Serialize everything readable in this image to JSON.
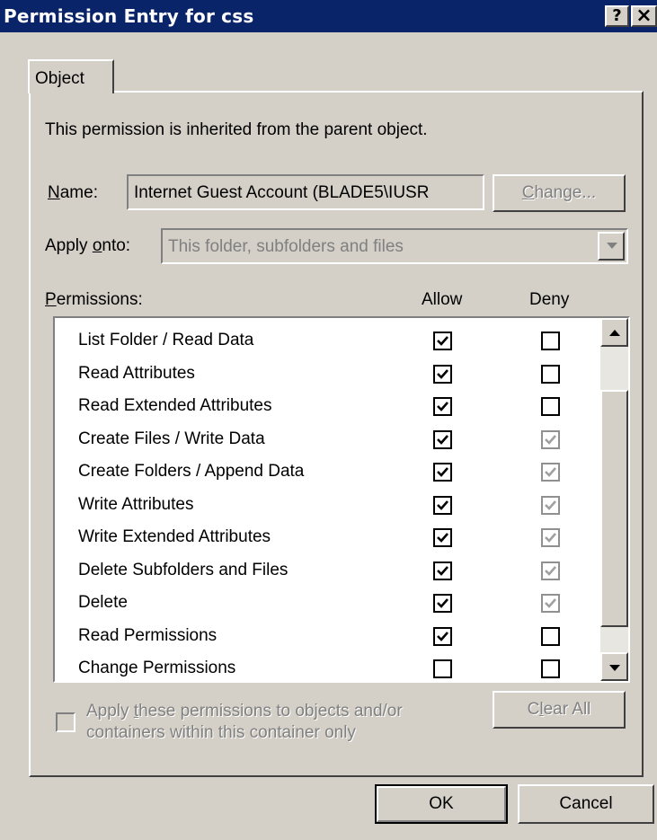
{
  "window": {
    "title": "Permission Entry for css",
    "help_btn": "?",
    "close_btn": "×"
  },
  "tab": {
    "label": "Object"
  },
  "inherited_text": "This permission is inherited from the parent object.",
  "name": {
    "label_u": "N",
    "label_rest": "ame:",
    "value": "Internet Guest Account (BLADE5\\IUSR",
    "change_u": "C",
    "change_rest": "hange..."
  },
  "apply_onto": {
    "label_pre": "Apply ",
    "label_u": "o",
    "label_rest": "nto:",
    "value": "This folder, subfolders and files"
  },
  "permissions": {
    "label_u": "P",
    "label_rest": "ermissions:",
    "allow_header": "Allow",
    "deny_header": "Deny",
    "rows": [
      {
        "name": "List Folder / Read Data",
        "allow": "checked",
        "deny": "unchecked"
      },
      {
        "name": "Read Attributes",
        "allow": "checked",
        "deny": "unchecked"
      },
      {
        "name": "Read Extended Attributes",
        "allow": "checked",
        "deny": "unchecked"
      },
      {
        "name": "Create Files / Write Data",
        "allow": "checked",
        "deny": "grey-checked"
      },
      {
        "name": "Create Folders / Append Data",
        "allow": "checked",
        "deny": "grey-checked"
      },
      {
        "name": "Write Attributes",
        "allow": "checked",
        "deny": "grey-checked"
      },
      {
        "name": "Write Extended Attributes",
        "allow": "checked",
        "deny": "grey-checked"
      },
      {
        "name": "Delete Subfolders and Files",
        "allow": "checked",
        "deny": "grey-checked"
      },
      {
        "name": "Delete",
        "allow": "checked",
        "deny": "grey-checked"
      },
      {
        "name": "Read Permissions",
        "allow": "checked",
        "deny": "unchecked"
      },
      {
        "name": "Change Permissions",
        "allow": "unchecked",
        "deny": "unchecked"
      }
    ]
  },
  "apply_these": {
    "line1_pre": "Apply ",
    "line1_u": "t",
    "line1_rest": "hese permissions to objects and/or",
    "line2": "containers within this container only"
  },
  "clear_all": {
    "pre": "C",
    "u": "l",
    "rest": "ear All"
  },
  "ok": "OK",
  "cancel": "Cancel",
  "colors": {
    "titlebar": "#0a246a",
    "face": "#d4d0c8"
  }
}
